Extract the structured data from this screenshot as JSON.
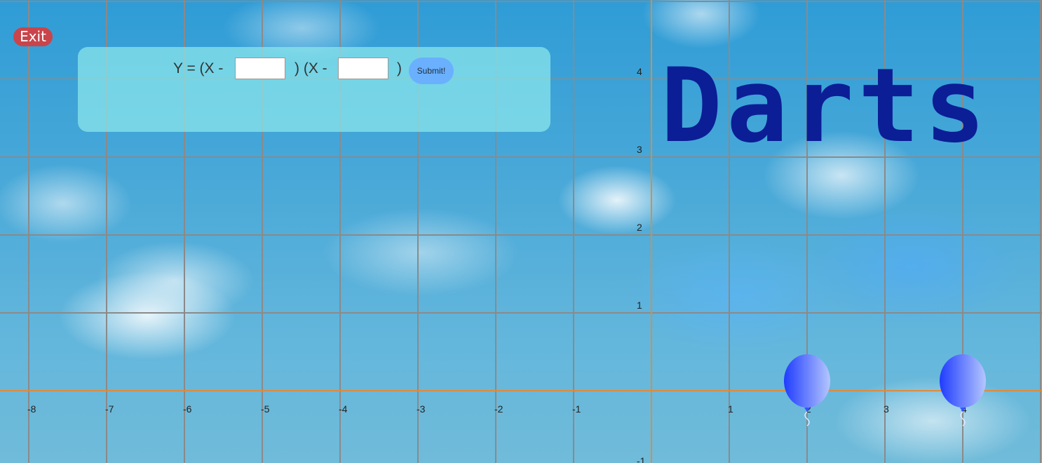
{
  "game": {
    "title": "Darts",
    "exit_label": "Exit"
  },
  "equation": {
    "prefix": "Y = (X -",
    "middle": ") (X -",
    "suffix": ")",
    "root1_value": "",
    "root2_value": "",
    "submit_label": "Submit!"
  },
  "graph": {
    "x_tick_labels": [
      "-8",
      "-7",
      "-6",
      "-5",
      "-4",
      "-3",
      "-2",
      "-1",
      "1",
      "2",
      "3",
      "4"
    ],
    "y_tick_labels": [
      "4",
      "3",
      "2",
      "1",
      "-1"
    ],
    "axis_color": "#e08a3a",
    "grid_color": "#8a8a8a"
  },
  "balloons": [
    {
      "x": 2,
      "y": 0,
      "color": "#3355ff"
    },
    {
      "x": 4,
      "y": 0,
      "color": "#3355ff"
    }
  ],
  "colors": {
    "title": "#0b1e96",
    "exit_button": "#c9454b",
    "panel": "#8ce8ec",
    "submit_button": "#6ab0ff"
  }
}
